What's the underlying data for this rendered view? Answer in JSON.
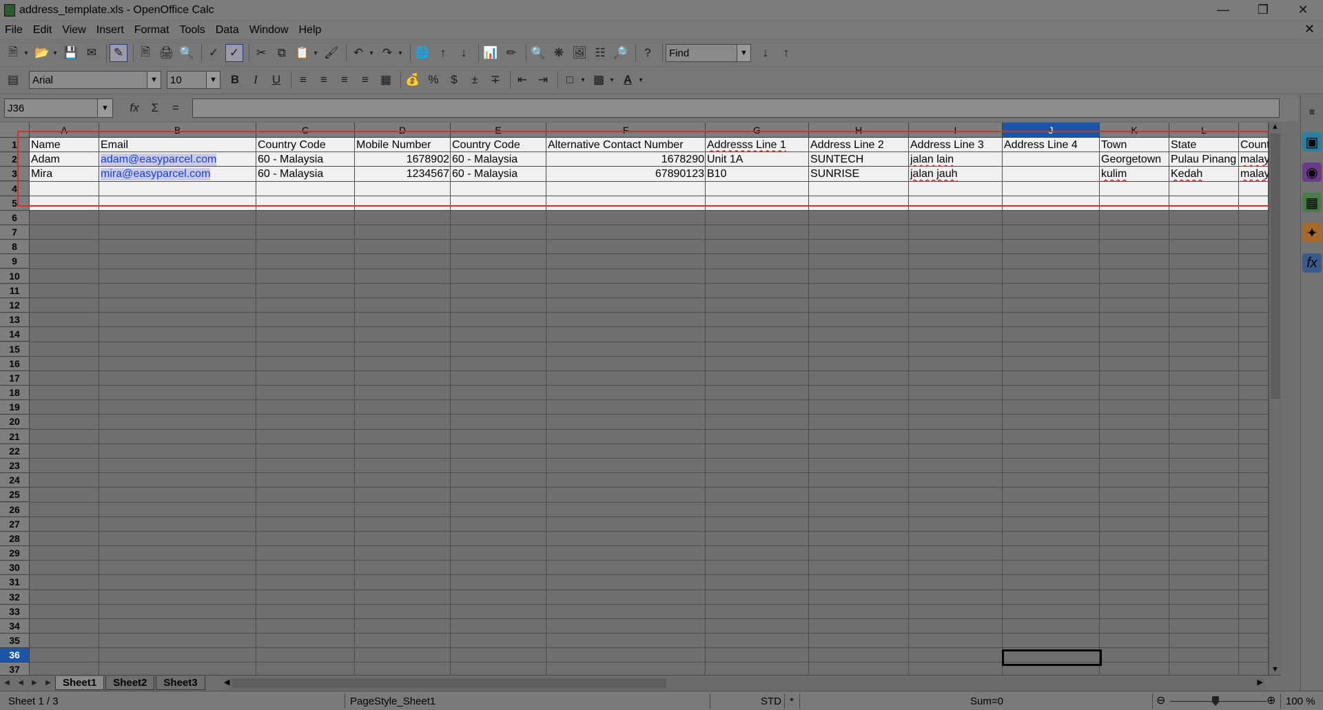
{
  "window": {
    "title": "address_template.xls - OpenOffice Calc"
  },
  "menu": [
    "File",
    "Edit",
    "View",
    "Insert",
    "Format",
    "Tools",
    "Data",
    "Window",
    "Help"
  ],
  "toolbar": {
    "find_placeholder": "Find"
  },
  "format": {
    "font_name": "Arial",
    "font_size": "10"
  },
  "formula": {
    "cell_ref": "J36",
    "content": ""
  },
  "columns": [
    {
      "letter": "A"
    },
    {
      "letter": "B"
    },
    {
      "letter": "C"
    },
    {
      "letter": "D"
    },
    {
      "letter": "E"
    },
    {
      "letter": "F"
    },
    {
      "letter": "G"
    },
    {
      "letter": "H"
    },
    {
      "letter": "I"
    },
    {
      "letter": "J"
    },
    {
      "letter": "K"
    },
    {
      "letter": "L"
    },
    {
      "letter": ""
    }
  ],
  "rows": [
    "1",
    "2",
    "3",
    "4",
    "5",
    "6",
    "7",
    "8",
    "9",
    "10",
    "11",
    "12",
    "13",
    "14",
    "15",
    "16",
    "17",
    "18",
    "19",
    "20",
    "21",
    "22",
    "23",
    "24",
    "25",
    "26",
    "27",
    "28",
    "29",
    "30",
    "31",
    "32",
    "33",
    "34",
    "35",
    "36",
    "37"
  ],
  "sheet": {
    "header": [
      "Name",
      "Email",
      "Country Code",
      "Mobile Number",
      "Country Code",
      "Alternative Contact Number",
      "Addresss Line 1",
      "Address Line 2",
      "Address Line 3",
      "Address Line 4",
      "Town",
      "State",
      "Count"
    ],
    "data": [
      [
        "Adam",
        "adam@easyparcel.com",
        "60 - Malaysia",
        "1678902",
        "60 - Malaysia",
        "1678290",
        "Unit 1A",
        "SUNTECH",
        "jalan lain",
        "",
        "Georgetown",
        "Pulau Pinang",
        "malay"
      ],
      [
        "Mira",
        "mira@easyparcel.com",
        "60 - Malaysia",
        "1234567",
        "60 - Malaysia",
        "67890123",
        "B10",
        "SUNRISE",
        "jalan jauh",
        "",
        "kulim",
        "Kedah",
        "malay"
      ]
    ]
  },
  "tabs": [
    "Sheet1",
    "Sheet2",
    "Sheet3"
  ],
  "status": {
    "sheet": "Sheet 1 / 3",
    "page_style": "PageStyle_Sheet1",
    "mode": "STD",
    "modified": "*",
    "sum": "Sum=0",
    "zoom": "100 %"
  },
  "colors": {
    "selection": "#1d54a8",
    "highlight_border": "#d0312d",
    "link": "#1a3fd0"
  }
}
